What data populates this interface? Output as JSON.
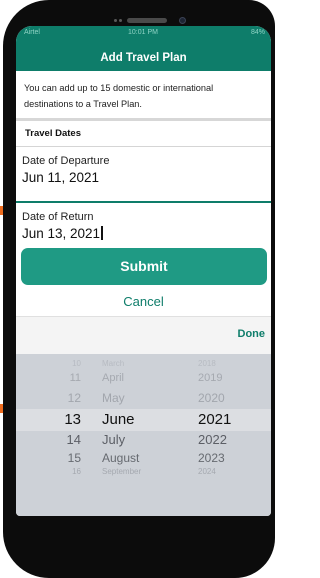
{
  "status_bar": {
    "carrier": "Airtel",
    "time": "10:01 PM",
    "battery": "84%"
  },
  "header": {
    "title": "Add Travel Plan"
  },
  "info": {
    "text": "You can add up to 15 domestic or international destinations to a Travel Plan."
  },
  "section": {
    "heading": "Travel Dates"
  },
  "departure": {
    "label": "Date of Departure",
    "value": "Jun 11, 2021"
  },
  "return_date": {
    "label": "Date of Return",
    "value": "Jun 13, 2021"
  },
  "actions": {
    "submit_label": "Submit",
    "cancel_label": "Cancel"
  },
  "picker": {
    "done_label": "Done",
    "rows": [
      {
        "day": "10",
        "month": "March",
        "year": "2018"
      },
      {
        "day": "11",
        "month": "April",
        "year": "2019"
      },
      {
        "day": "12",
        "month": "May",
        "year": "2020"
      },
      {
        "day": "13",
        "month": "June",
        "year": "2021"
      },
      {
        "day": "14",
        "month": "July",
        "year": "2022"
      },
      {
        "day": "15",
        "month": "August",
        "year": "2023"
      },
      {
        "day": "16",
        "month": "September",
        "year": "2024"
      }
    ]
  },
  "colors": {
    "brand": "#0e7d6a",
    "button": "#1f9a84",
    "tab_marker": "#ef6c1e"
  }
}
